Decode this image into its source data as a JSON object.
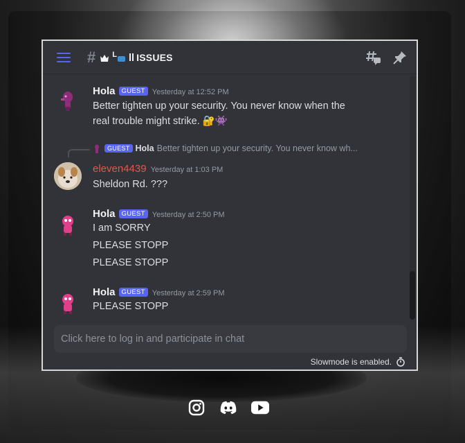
{
  "header": {
    "channel_hash": "#",
    "channel_l": "L",
    "channel_title": "ISSUES"
  },
  "messages": [
    {
      "author": "Hola",
      "badge": "GUEST",
      "time": "Yesterday at 12:52 PM",
      "lines": [
        "Better tighten up your security. You never know when the",
        "real trouble might strike. 🔐👾"
      ]
    },
    {
      "reply": {
        "badge": "GUEST",
        "author": "Hola",
        "snippet": "Better tighten up your security. You never know wh..."
      },
      "author": "eleven4439",
      "time": "Yesterday at 1:03 PM",
      "lines": [
        "Sheldon Rd. ???"
      ]
    },
    {
      "author": "Hola",
      "badge": "GUEST",
      "time": "Yesterday at 2:50 PM",
      "lines": [
        "I am SORRY",
        "PLEASE STOPP",
        "PLEASE STOPP"
      ]
    },
    {
      "author": "Hola",
      "badge": "GUEST",
      "time": "Yesterday at 2:59 PM",
      "lines": [
        "PLEASE STOPP"
      ]
    }
  ],
  "composer": {
    "placeholder": "Click here to log in and participate in chat"
  },
  "slowmode": {
    "text": "Slowmode is enabled."
  },
  "icons": {
    "menu": "hamburger-icon",
    "threads": "threads-icon",
    "pin": "pin-icon",
    "slowmode": "stopwatch-icon",
    "social": [
      "instagram-icon",
      "discord-icon",
      "youtube-icon"
    ]
  },
  "colors": {
    "accent": "#5865f2",
    "username_red": "#e2574b",
    "background": "#313338"
  }
}
